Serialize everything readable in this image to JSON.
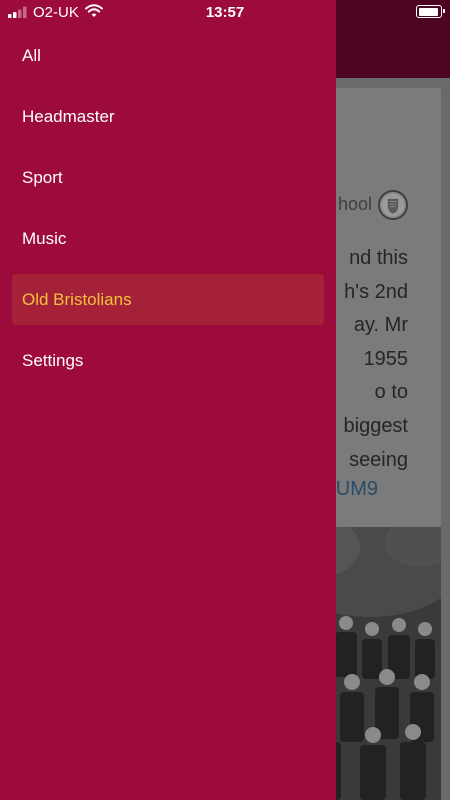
{
  "status_bar": {
    "carrier": "O2-UK",
    "time": "13:57",
    "signal_bars": 2,
    "battery_level": 0.95
  },
  "drawer": {
    "items": [
      {
        "label": "All",
        "active": false
      },
      {
        "label": "Headmaster",
        "active": false
      },
      {
        "label": "Sport",
        "active": false
      },
      {
        "label": "Music",
        "active": false
      },
      {
        "label": "Old Bristolians",
        "active": true
      },
      {
        "label": "Settings",
        "active": false
      }
    ],
    "colors": {
      "background": "#9d0b3c",
      "active_background": "#a52137",
      "active_text": "#f4c13e",
      "text": "#ffffff"
    }
  },
  "background_post": {
    "source_fragment": "hool",
    "text_fragment": "nd this\nh's 2nd\nay. Mr\n1955\no to\nbiggest\nseeing",
    "link_fragment": "UM9"
  }
}
